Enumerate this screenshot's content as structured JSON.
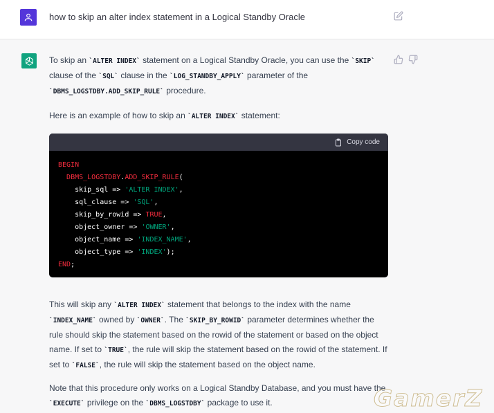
{
  "user": {
    "prompt": "how to skip an alter index statement in a Logical Standby Oracle"
  },
  "answer": {
    "p1": [
      {
        "t": "To skip an "
      },
      {
        "c": "`ALTER INDEX`"
      },
      {
        "t": " statement on a Logical Standby Oracle, you can use the "
      },
      {
        "c": "`SKIP`"
      },
      {
        "t": " clause of the "
      },
      {
        "c": "`SQL`"
      },
      {
        "t": " clause in the "
      },
      {
        "c": "`LOG_STANDBY_APPLY`"
      },
      {
        "t": " parameter of the "
      },
      {
        "c": "`DBMS_LOGSTDBY.ADD_SKIP_RULE`"
      },
      {
        "t": " procedure."
      }
    ],
    "p2": [
      {
        "t": "Here is an example of how to skip an "
      },
      {
        "c": "`ALTER INDEX`"
      },
      {
        "t": " statement:"
      }
    ],
    "code_copy_label": "Copy code",
    "code_lines": [
      [
        {
          "k": "BEGIN"
        }
      ],
      [
        {
          "t": "  "
        },
        {
          "k": "DBMS_LOGSTDBY"
        },
        {
          "t": "."
        },
        {
          "k": "ADD_SKIP_RULE"
        },
        {
          "t": "("
        }
      ],
      [
        {
          "t": "    skip_sql => "
        },
        {
          "s": "'ALTER INDEX'"
        },
        {
          "t": ","
        }
      ],
      [
        {
          "t": "    sql_clause => "
        },
        {
          "s": "'SQL'"
        },
        {
          "t": ","
        }
      ],
      [
        {
          "t": "    skip_by_rowid => "
        },
        {
          "k": "TRUE"
        },
        {
          "t": ","
        }
      ],
      [
        {
          "t": "    object_owner => "
        },
        {
          "s": "'OWNER'"
        },
        {
          "t": ","
        }
      ],
      [
        {
          "t": "    object_name => "
        },
        {
          "s": "'INDEX_NAME'"
        },
        {
          "t": ","
        }
      ],
      [
        {
          "t": "    object_type => "
        },
        {
          "s": "'INDEX'"
        },
        {
          "t": ");"
        }
      ],
      [
        {
          "k": "END"
        },
        {
          "t": ";"
        }
      ]
    ],
    "p3": [
      {
        "t": "This will skip any "
      },
      {
        "c": "`ALTER INDEX`"
      },
      {
        "t": " statement that belongs to the index with the name "
      },
      {
        "c": "`INDEX_NAME`"
      },
      {
        "t": " owned by "
      },
      {
        "c": "`OWNER`"
      },
      {
        "t": ". The "
      },
      {
        "c": "`SKIP_BY_ROWID`"
      },
      {
        "t": " parameter determines whether the rule should skip the statement based on the rowid of the statement or based on the object name. If set to "
      },
      {
        "c": "`TRUE`"
      },
      {
        "t": ", the rule will skip the statement based on the rowid of the statement. If set to "
      },
      {
        "c": "`FALSE`"
      },
      {
        "t": ", the rule will skip the statement based on the object name."
      }
    ],
    "p4": [
      {
        "t": "Note that this procedure only works on a Logical Standby Database, and you must have the "
      },
      {
        "c": "`EXECUTE`"
      },
      {
        "t": " privilege on the "
      },
      {
        "c": "`DBMS_LOGSTDBY`"
      },
      {
        "t": " package to use it."
      }
    ]
  },
  "watermark": "GamerZ",
  "icons": {
    "user_avatar": "user-icon",
    "assistant_avatar": "openai-logo-icon",
    "edit": "edit-icon",
    "thumbs_up": "thumbs-up-icon",
    "thumbs_down": "thumbs-down-icon",
    "copy": "clipboard-icon"
  },
  "colors": {
    "user_avatar_bg": "#5436da",
    "assistant_avatar_bg": "#10a37f",
    "code_bg": "#000000",
    "code_keyword": "#f22c3d",
    "code_string": "#00a67d"
  }
}
